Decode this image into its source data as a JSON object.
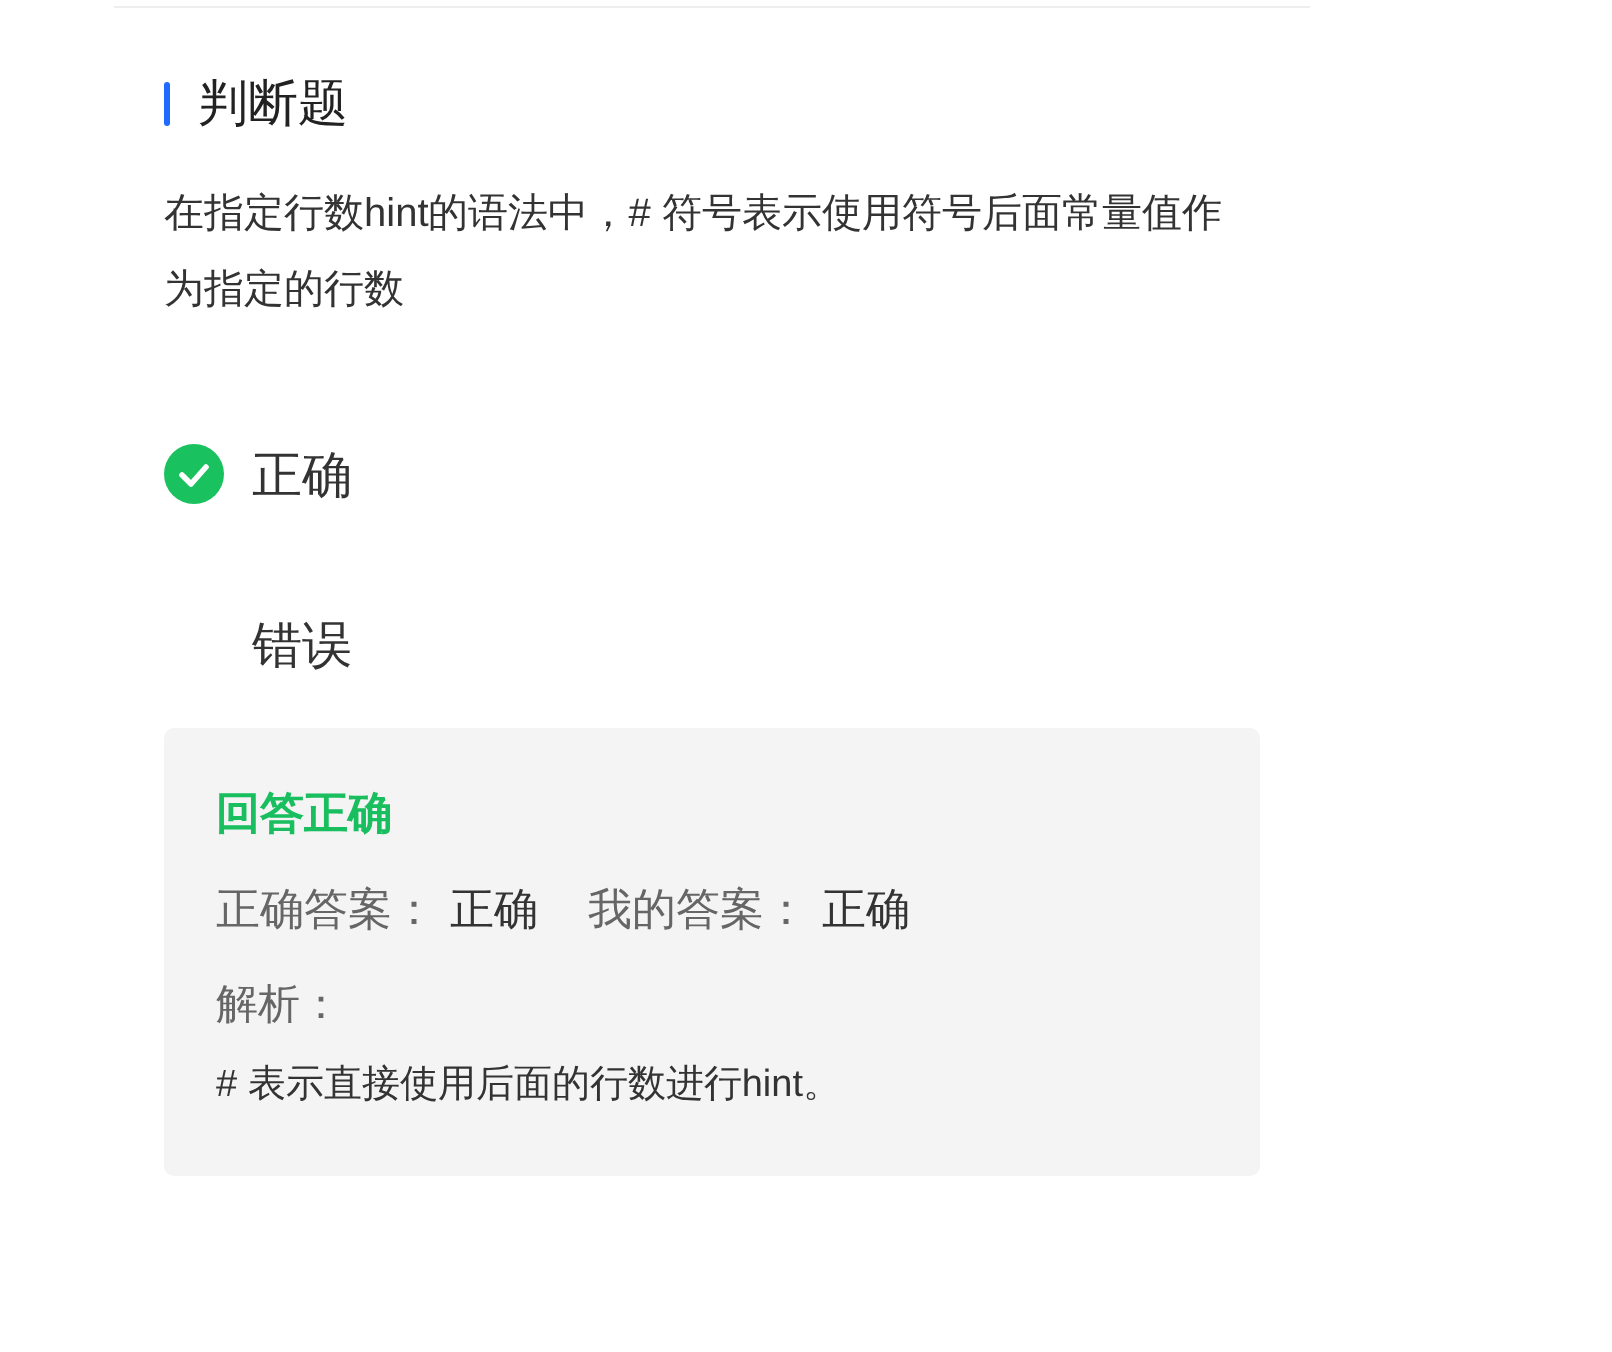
{
  "section": {
    "title": "判断题"
  },
  "question": {
    "text": "在指定行数hint的语法中，# 符号表示使用符号后面常量值作为指定的行数"
  },
  "options": [
    {
      "label": "正确",
      "selected": true
    },
    {
      "label": "错误",
      "selected": false
    }
  ],
  "result": {
    "status": "回答正确",
    "correct": true,
    "answers": [
      {
        "label": "正确答案：",
        "value": "正确"
      },
      {
        "label": "我的答案：",
        "value": "正确"
      }
    ],
    "explanation": {
      "label": "解析：",
      "text": "# 表示直接使用后面的行数进行hint。"
    }
  }
}
